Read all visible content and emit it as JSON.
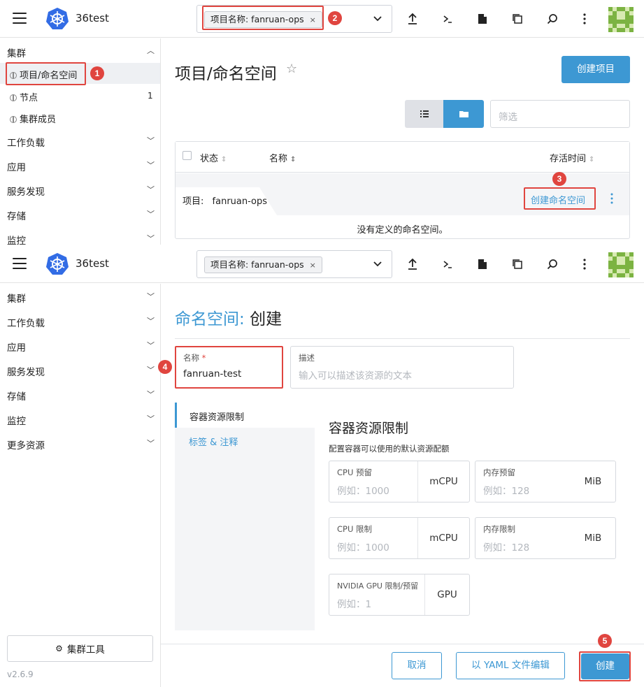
{
  "header": {
    "cluster_name": "36test",
    "ns_chip": "项目名称: fanruan-ops",
    "ns_chip_close": "×"
  },
  "top": {
    "sidebar": {
      "cluster_group": "集群",
      "items": [
        {
          "label": "项目/命名空间"
        },
        {
          "label": "节点",
          "count": "1"
        },
        {
          "label": "集群成员"
        }
      ],
      "groups": [
        "工作负载",
        "应用",
        "服务发现",
        "存储",
        "监控"
      ]
    },
    "main": {
      "title": "项目/命名空间",
      "create_project_btn": "创建项目",
      "filter_placeholder": "筛选",
      "table": {
        "col_state": "状态",
        "col_name": "名称",
        "col_age": "存活时间",
        "group_prefix": "项目:",
        "group_name": "fanruan-ops",
        "create_ns_link": "创建命名空间",
        "empty_text": "没有定义的命名空间。"
      }
    }
  },
  "bottom": {
    "sidebar": {
      "groups": [
        "集群",
        "工作负载",
        "应用",
        "服务发现",
        "存储",
        "监控",
        "更多资源"
      ],
      "cluster_tools_btn": "集群工具",
      "version": "v2.6.9"
    },
    "main": {
      "title_prefix": "命名空间:",
      "title_action": "创建",
      "name_label": "名称",
      "name_value": "fanruan-test",
      "desc_label": "描述",
      "desc_placeholder": "输入可以描述该资源的文本",
      "tabs": [
        "容器资源限制",
        "标签 & 注释"
      ],
      "section_title": "容器资源限制",
      "section_subtitle": "配置容器可以使用的默认资源配额",
      "fields": {
        "cpu_reserve": {
          "label": "CPU 预留",
          "placeholder": "例如：1000",
          "unit": "mCPU"
        },
        "mem_reserve": {
          "label": "内存预留",
          "placeholder": "例如：128",
          "unit": "MiB"
        },
        "cpu_limit": {
          "label": "CPU 限制",
          "placeholder": "例如：1000",
          "unit": "mCPU"
        },
        "mem_limit": {
          "label": "内存限制",
          "placeholder": "例如：128",
          "unit": "MiB"
        },
        "gpu": {
          "label": "NVIDIA GPU 限制/预留",
          "placeholder": "例如：1",
          "unit": "GPU"
        }
      },
      "cancel_btn": "取消",
      "yaml_btn": "以 YAML 文件编辑",
      "create_btn": "创建"
    }
  },
  "annotations": [
    "1",
    "2",
    "3",
    "4",
    "5"
  ],
  "colors": {
    "accent": "#3d98d3",
    "annotation": "#e0453f"
  }
}
